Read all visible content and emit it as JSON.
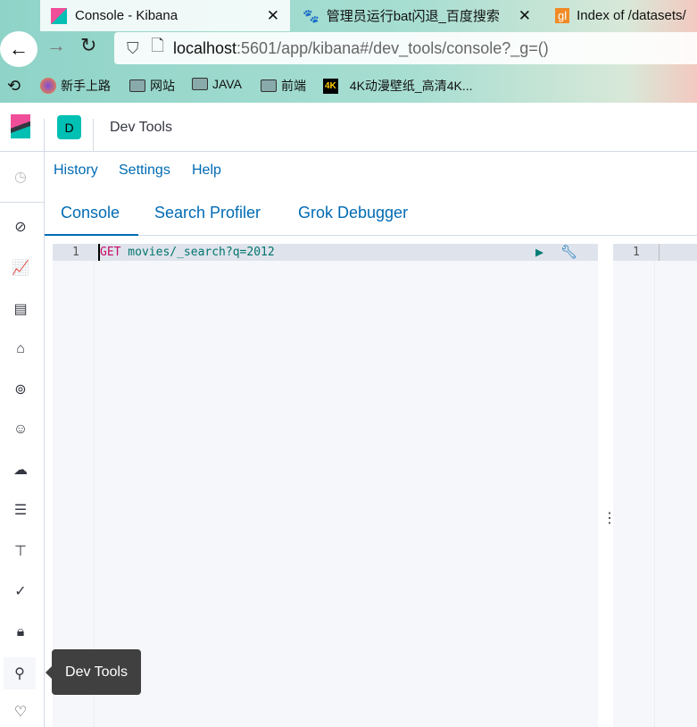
{
  "browser": {
    "tabs": [
      {
        "title": "Console - Kibana",
        "active": true
      },
      {
        "title": "管理员运行bat闪退_百度搜索"
      },
      {
        "title": "Index of /datasets/"
      }
    ],
    "url_host": "localhost",
    "url_path": ":5601/app/kibana#/dev_tools/console?_g=()",
    "bookmarks": [
      "新手上路",
      "网站",
      "JAVA",
      "前端",
      "4K动漫壁纸_高清4K..."
    ]
  },
  "header": {
    "space_badge": "D",
    "title": "Dev Tools"
  },
  "subnav": [
    "History",
    "Settings",
    "Help"
  ],
  "tabs": [
    "Console",
    "Search Profiler",
    "Grok Debugger"
  ],
  "editor": {
    "line_number": "1",
    "method": "GET",
    "path": " movies/_search?q=2012",
    "output_line": "1"
  },
  "tooltip": "Dev Tools",
  "colors": {
    "accent": "#006bb4",
    "method": "#c80a68",
    "code": "#00756c"
  }
}
